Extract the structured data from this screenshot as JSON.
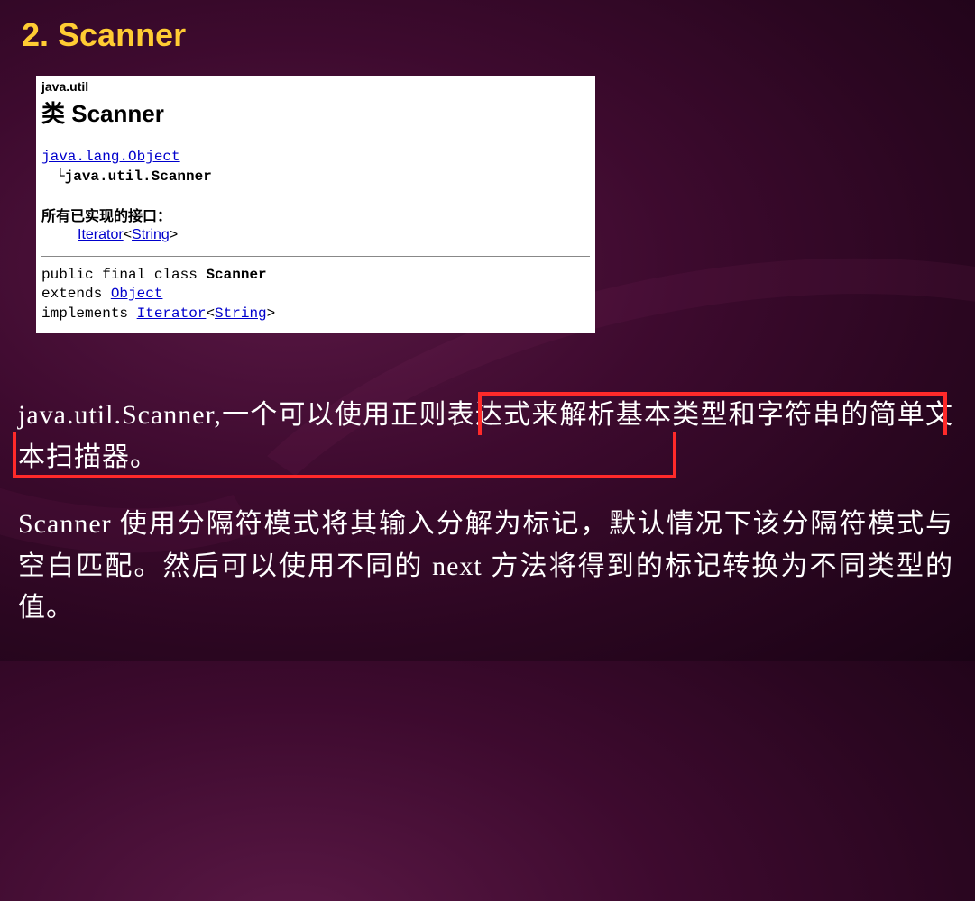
{
  "title": "2. Scanner",
  "javadoc": {
    "package": "java.util",
    "class_prefix": "类 ",
    "class_name": "Scanner",
    "hierarchy": {
      "root_link": "java.lang.Object",
      "child": "java.util.Scanner"
    },
    "interfaces": {
      "label": "所有已实现的接口：",
      "iterator": "Iterator",
      "lt": "<",
      "string": "String",
      "gt": ">"
    },
    "decl": {
      "line1_pre": "public final class ",
      "line1_bold": "Scanner",
      "line2_pre": "extends ",
      "line2_link": "Object",
      "line3_pre": "implements ",
      "line3_link1": "Iterator",
      "line3_lt": "<",
      "line3_link2": "String",
      "line3_gt": ">"
    }
  },
  "description": {
    "p1": "java.util.Scanner,一个可以使用正则表达式来解析基本类型和字符串的简单文本扫描器。",
    "p2": "Scanner 使用分隔符模式将其输入分解为标记，默认情况下该分隔符模式与空白匹配。然后可以使用不同的 next 方法将得到的标记转换为不同类型的值。"
  }
}
